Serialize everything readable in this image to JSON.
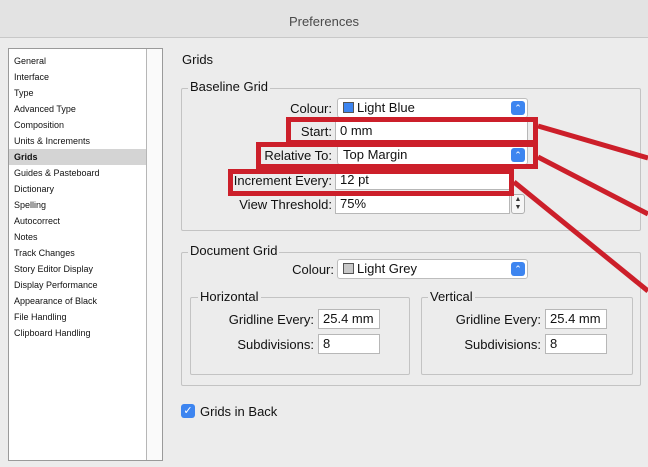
{
  "window": {
    "title": "Preferences"
  },
  "sidebar": {
    "items": [
      {
        "label": "General"
      },
      {
        "label": "Interface"
      },
      {
        "label": "Type"
      },
      {
        "label": "Advanced Type"
      },
      {
        "label": "Composition"
      },
      {
        "label": "Units & Increments"
      },
      {
        "label": "Grids",
        "selected": true
      },
      {
        "label": "Guides & Pasteboard"
      },
      {
        "label": "Dictionary"
      },
      {
        "label": "Spelling"
      },
      {
        "label": "Autocorrect"
      },
      {
        "label": "Notes"
      },
      {
        "label": "Track Changes"
      },
      {
        "label": "Story Editor Display"
      },
      {
        "label": "Display Performance"
      },
      {
        "label": "Appearance of Black"
      },
      {
        "label": "File Handling"
      },
      {
        "label": "Clipboard Handling"
      }
    ]
  },
  "panel": {
    "title": "Grids"
  },
  "baseline_grid": {
    "label": "Baseline Grid",
    "colour_label": "Colour:",
    "colour_value": "Light Blue",
    "colour_swatch": "#3d85f0",
    "start_label": "Start:",
    "start_value": "0 mm",
    "relative_label": "Relative To:",
    "relative_value": "Top Margin",
    "increment_label": "Increment Every:",
    "increment_value": "12 pt",
    "threshold_label": "View Threshold:",
    "threshold_value": "75%"
  },
  "document_grid": {
    "label": "Document Grid",
    "colour_label": "Colour:",
    "colour_value": "Light Grey",
    "colour_swatch": "#c8c8c8",
    "horizontal": {
      "label": "Horizontal",
      "gridline_label": "Gridline Every:",
      "gridline_value": "25.4 mm",
      "subdivisions_label": "Subdivisions:",
      "subdivisions_value": "8"
    },
    "vertical": {
      "label": "Vertical",
      "gridline_label": "Gridline Every:",
      "gridline_value": "25.4 mm",
      "subdivisions_label": "Subdivisions:",
      "subdivisions_value": "8"
    }
  },
  "grids_in_back": {
    "label": "Grids in Back",
    "checked": true
  },
  "annotation": {
    "color": "#cc1f2a"
  },
  "icons": {
    "select_arrows": "select-arrows-icon",
    "check": "checkmark-icon"
  }
}
